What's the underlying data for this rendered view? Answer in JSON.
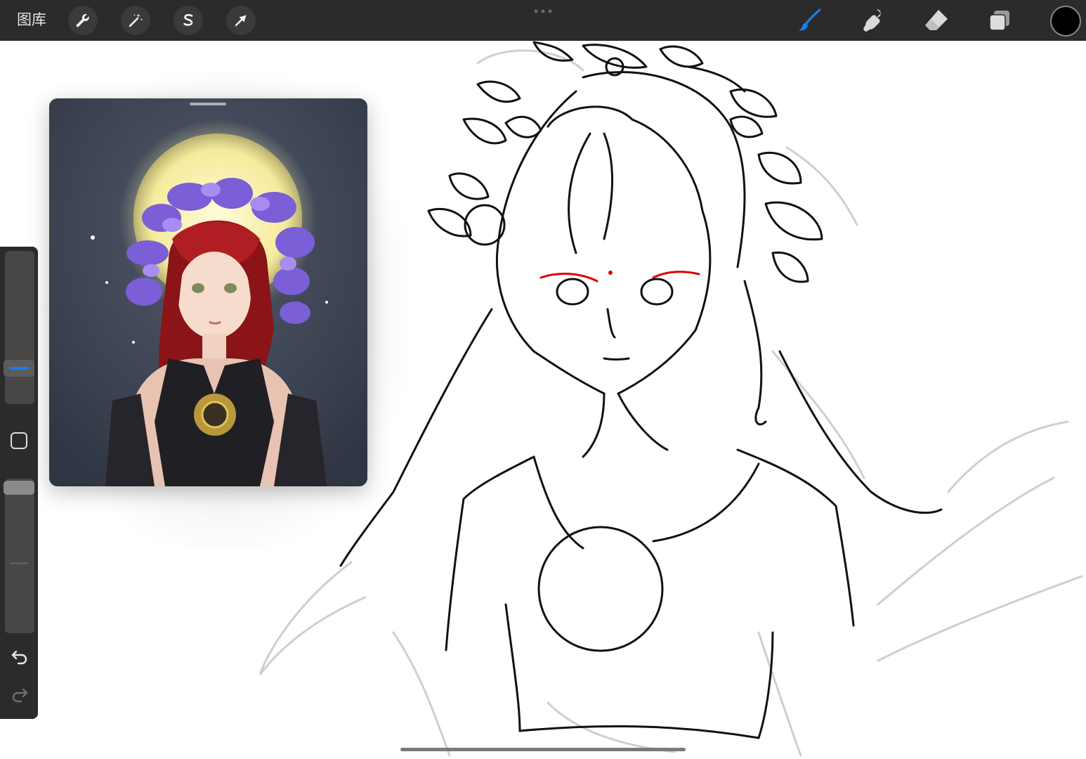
{
  "toolbar": {
    "gallery_label": "图库",
    "left_tools": [
      {
        "name": "actions",
        "icon": "wrench-icon"
      },
      {
        "name": "adjustments",
        "icon": "magic-wand-icon"
      },
      {
        "name": "selection",
        "icon": "selection-s-icon"
      },
      {
        "name": "transform",
        "icon": "arrow-cursor-icon"
      }
    ],
    "right_tools": [
      {
        "name": "brush",
        "icon": "brush-icon",
        "active": true
      },
      {
        "name": "smudge",
        "icon": "smudge-icon",
        "active": false
      },
      {
        "name": "eraser",
        "icon": "eraser-icon",
        "active": false
      },
      {
        "name": "layers",
        "icon": "layers-icon",
        "active": false
      }
    ],
    "current_color": "#000000",
    "active_color": "#1a7df0"
  },
  "sidebar": {
    "brush_size_level": 0.2,
    "opacity_level": 1.0,
    "undo_icon": "undo-icon",
    "redo_icon": "redo-icon",
    "modify_icon": "square-modify-icon"
  },
  "reference": {
    "visible": true
  }
}
